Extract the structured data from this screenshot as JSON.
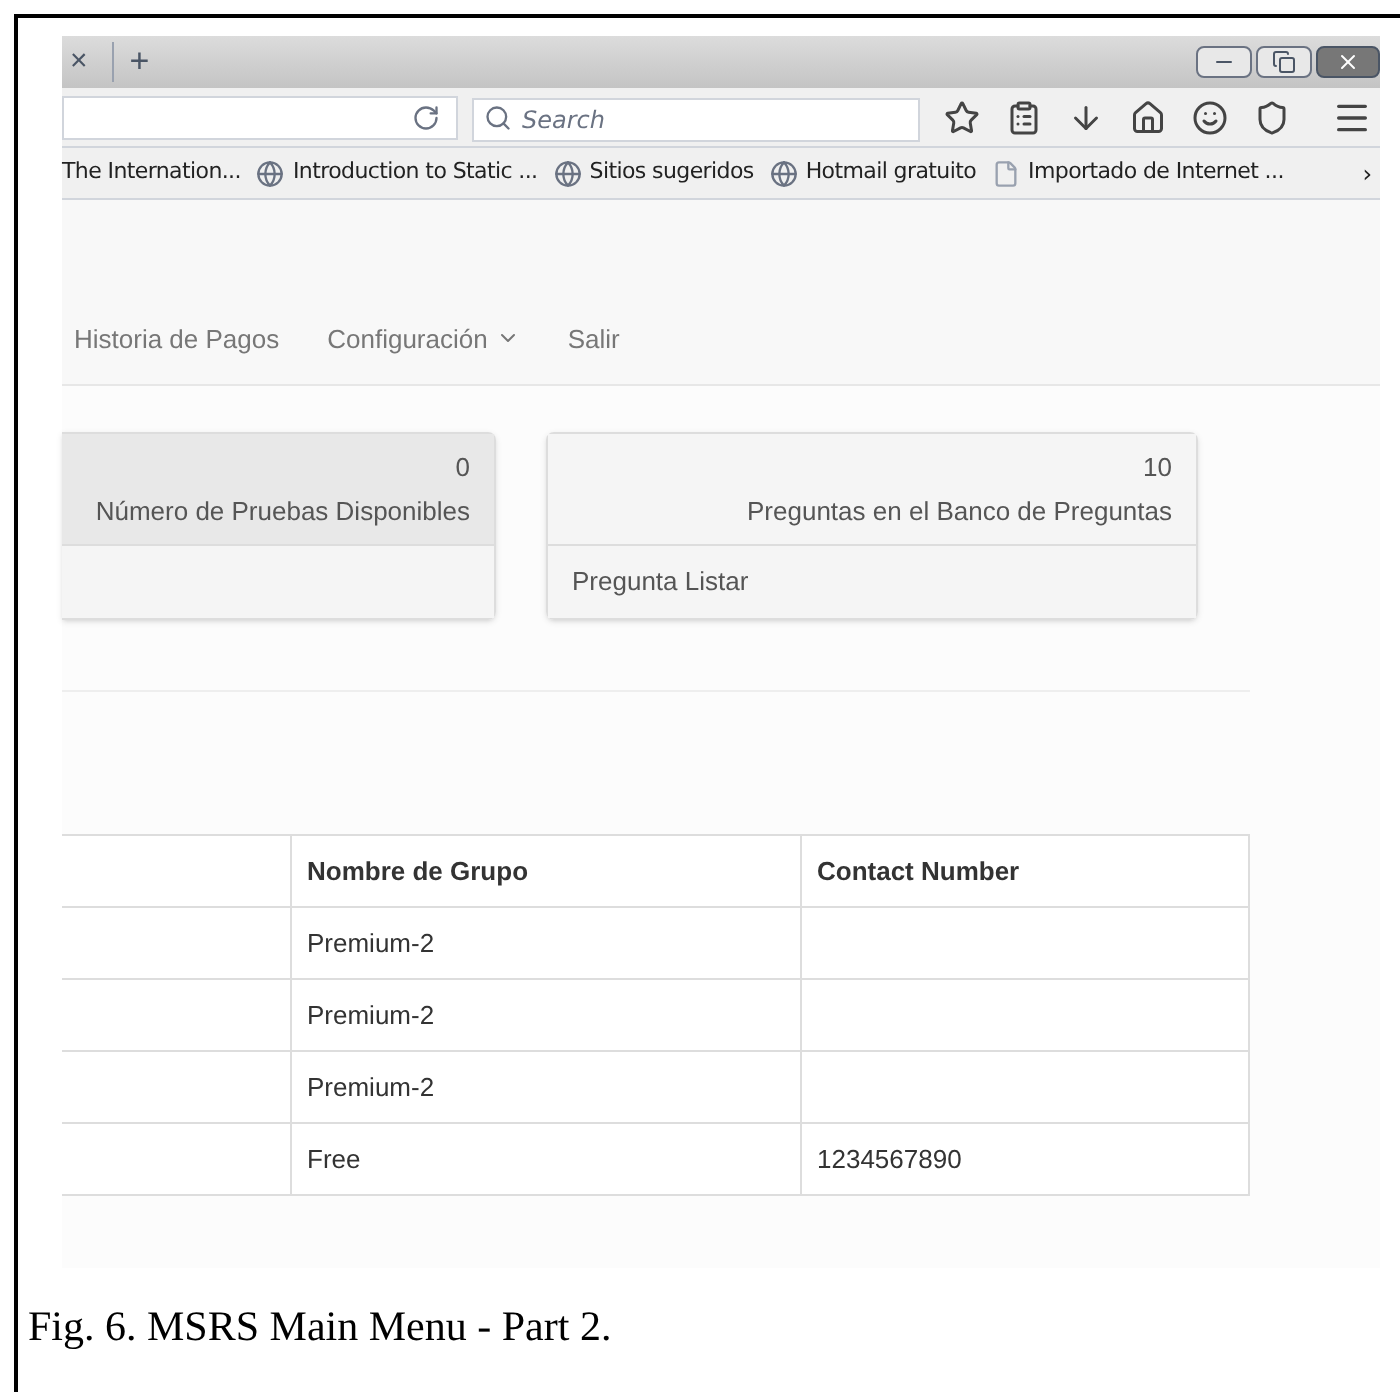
{
  "browser": {
    "tab_close": "×",
    "new_tab": "+",
    "search": {
      "placeholder": "Search"
    },
    "bookmarks": [
      {
        "label": "The Internation...",
        "kind": "plain"
      },
      {
        "label": "Introduction to Static ...",
        "kind": "globe"
      },
      {
        "label": "Sitios sugeridos",
        "kind": "globe"
      },
      {
        "label": "Hotmail gratuito",
        "kind": "globe"
      },
      {
        "label": "Importado de Internet ...",
        "kind": "page"
      }
    ],
    "bookmarks_more": "›"
  },
  "navbar": {
    "items": [
      {
        "label": "Historia de Pagos",
        "dropdown": false
      },
      {
        "label": "Configuración",
        "dropdown": true
      },
      {
        "label": "Salir",
        "dropdown": false
      }
    ]
  },
  "panels": [
    {
      "count": "0",
      "label": "Número de Pruebas Disponibles",
      "highlighted": true
    },
    {
      "count": "10",
      "label": "Preguntas en el Banco de Preguntas",
      "highlighted": false,
      "link": "Pregunta Listar"
    }
  ],
  "table": {
    "columns": [
      "Nombre de Grupo",
      "Contact Number"
    ],
    "rows": [
      {
        "group": "Premium-2"
      },
      {
        "group": "Premium-2"
      },
      {
        "group": "Premium-2"
      },
      {
        "group": "Free",
        "contact": "1234567890"
      }
    ]
  },
  "caption": "Fig. 6. MSRS Main Menu - Part 2."
}
